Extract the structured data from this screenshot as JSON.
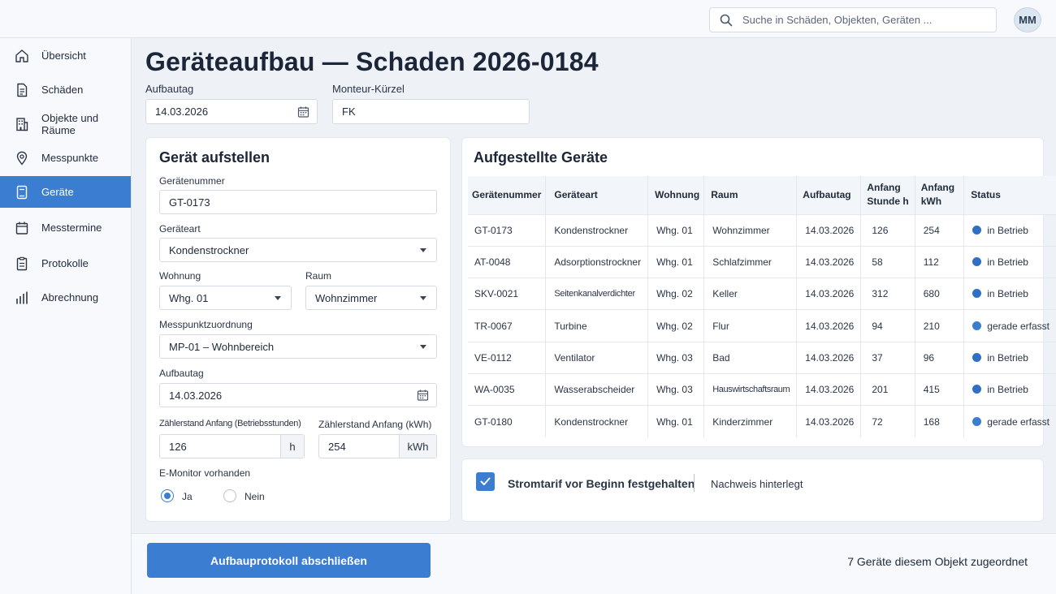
{
  "search": {
    "placeholder": "Suche in Schäden, Objekten, Geräten ..."
  },
  "user": {
    "initials": "MM"
  },
  "sidebar": {
    "items": [
      {
        "label": "Übersicht",
        "icon": "home-icon"
      },
      {
        "label": "Schäden",
        "icon": "document-icon"
      },
      {
        "label": "Objekte und Räume",
        "icon": "building-icon"
      },
      {
        "label": "Messpunkte",
        "icon": "map-pin-icon"
      },
      {
        "label": "Geräte",
        "icon": "device-icon",
        "active": true
      },
      {
        "label": "Messtermine",
        "icon": "calendar-icon"
      },
      {
        "label": "Protokolle",
        "icon": "clipboard-icon"
      },
      {
        "label": "Abrechnung",
        "icon": "bar-chart-icon"
      }
    ]
  },
  "page": {
    "title": "Geräteaufbau — Schaden 2026-0184",
    "aufbautag_label": "Aufbautag",
    "aufbautag_value": "14.03.2026",
    "monteur_label": "Monteur-Kürzel",
    "monteur_value": "FK"
  },
  "form": {
    "title": "Gerät aufstellen",
    "geraetenummer_label": "Gerätenummer",
    "geraetenummer_value": "GT-0173",
    "geraeteart_label": "Geräteart",
    "geraeteart_value": "Kondenstrockner",
    "wohnung_label": "Wohnung",
    "wohnung_value": "Whg. 01",
    "raum_label": "Raum",
    "raum_value": "Wohnzimmer",
    "messpunkt_label": "Messpunktzuordnung",
    "messpunkt_value": "MP-01 – Wohnbereich",
    "aufbautag_label": "Aufbautag",
    "aufbautag_value": "14.03.2026",
    "zaehler_h_label": "Zählerstand Anfang (Betriebsstunden)",
    "zaehler_h_value": "126",
    "zaehler_h_unit": "h",
    "zaehler_kwh_label": "Zählerstand Anfang (kWh)",
    "zaehler_kwh_value": "254",
    "zaehler_kwh_unit": "kWh",
    "emonitor_label": "E-Monitor vorhanden",
    "radio_ja": "Ja",
    "radio_nein": "Nein",
    "emonitor_selected": "Ja"
  },
  "devices": {
    "title": "Aufgestellte Geräte",
    "columns": [
      "Gerätenummer",
      "Geräteart",
      "Wohnung",
      "Raum",
      "Aufbautag",
      "Anfang Stunde h",
      "Anfang kWh",
      "Status"
    ],
    "status_colors": {
      "in Betrieb": "#2f6fc6",
      "gerade erfasst": "#3b7dd0"
    },
    "rows": [
      {
        "nr": "GT-0173",
        "art": "Kondenstrockner",
        "whg": "Whg. 01",
        "raum": "Wohnzimmer",
        "tag": "14.03.2026",
        "h": "126",
        "kwh": "254",
        "status": "in Betrieb"
      },
      {
        "nr": "AT-0048",
        "art": "Adsorptionstrockner",
        "whg": "Whg. 01",
        "raum": "Schlafzimmer",
        "tag": "14.03.2026",
        "h": "58",
        "kwh": "112",
        "status": "in Betrieb"
      },
      {
        "nr": "SKV-0021",
        "art": "Seitenkanalverdichter",
        "whg": "Whg. 02",
        "raum": "Keller",
        "tag": "14.03.2026",
        "h": "312",
        "kwh": "680",
        "status": "in Betrieb"
      },
      {
        "nr": "TR-0067",
        "art": "Turbine",
        "whg": "Whg. 02",
        "raum": "Flur",
        "tag": "14.03.2026",
        "h": "94",
        "kwh": "210",
        "status": "gerade erfasst"
      },
      {
        "nr": "VE-0112",
        "art": "Ventilator",
        "whg": "Whg. 03",
        "raum": "Bad",
        "tag": "14.03.2026",
        "h": "37",
        "kwh": "96",
        "status": "in Betrieb"
      },
      {
        "nr": "WA-0035",
        "art": "Wasserabscheider",
        "whg": "Whg. 03",
        "raum": "Hauswirtschaftsraum",
        "tag": "14.03.2026",
        "h": "201",
        "kwh": "415",
        "status": "in Betrieb"
      },
      {
        "nr": "GT-0180",
        "art": "Kondenstrockner",
        "whg": "Whg. 01",
        "raum": "Kinderzimmer",
        "tag": "14.03.2026",
        "h": "72",
        "kwh": "168",
        "status": "gerade erfasst"
      }
    ]
  },
  "tariff": {
    "checked": true,
    "label": "Stromtarif vor Beginn festgehalten",
    "proof": "Nachweis hinterlegt"
  },
  "footer": {
    "button": "Aufbauprotokoll abschließen",
    "count": "7 Geräte diesem Objekt zugeordnet"
  }
}
